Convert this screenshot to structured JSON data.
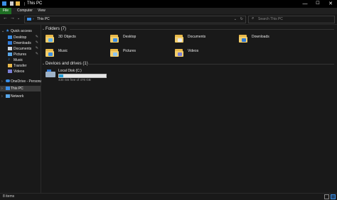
{
  "window": {
    "title": "This PC",
    "controls": {
      "minimize": "—",
      "maximize": "☐",
      "close": "✕"
    }
  },
  "ribbon": {
    "tabs": [
      {
        "label": "File",
        "active": true
      },
      {
        "label": "Computer",
        "active": false
      },
      {
        "label": "View",
        "active": false
      }
    ]
  },
  "address": {
    "path": "This PC",
    "search_placeholder": "Search This PC"
  },
  "navigation": {
    "quick_access_label": "Quick access",
    "quick_items": [
      {
        "label": "Desktop",
        "icon": "desktop-icon",
        "pinned": true
      },
      {
        "label": "Downloads",
        "icon": "downloads-icon",
        "pinned": true
      },
      {
        "label": "Documents",
        "icon": "documents-icon",
        "pinned": true
      },
      {
        "label": "Pictures",
        "icon": "pictures-icon",
        "pinned": true
      },
      {
        "label": "Music",
        "icon": "music-icon",
        "pinned": false
      },
      {
        "label": "Transfer",
        "icon": "folder-icon",
        "pinned": false
      },
      {
        "label": "Videos",
        "icon": "videos-icon",
        "pinned": false
      }
    ],
    "onedrive_label": "OneDrive - Personal",
    "thispc_label": "This PC",
    "network_label": "Network"
  },
  "content": {
    "folders_header": "Folders (7)",
    "folders": [
      {
        "label": "3D Objects",
        "icon": "3d-objects-icon"
      },
      {
        "label": "Desktop",
        "icon": "desktop-folder-icon"
      },
      {
        "label": "Documents",
        "icon": "documents-folder-icon"
      },
      {
        "label": "Downloads",
        "icon": "downloads-folder-icon"
      },
      {
        "label": "Music",
        "icon": "music-folder-icon"
      },
      {
        "label": "Pictures",
        "icon": "pictures-folder-icon"
      },
      {
        "label": "Videos",
        "icon": "videos-folder-icon"
      }
    ],
    "drives_header": "Devices and drives (1)",
    "drives": [
      {
        "label": "Local Disk (C:)",
        "free_text": "430 GB free of 476 GB",
        "used_fraction": 0.097
      }
    ]
  },
  "status": {
    "item_count": "8 items"
  },
  "colors": {
    "accent": "#1f6f24",
    "folder": "#f3ce6b",
    "drive_fill": "#26a0da"
  }
}
